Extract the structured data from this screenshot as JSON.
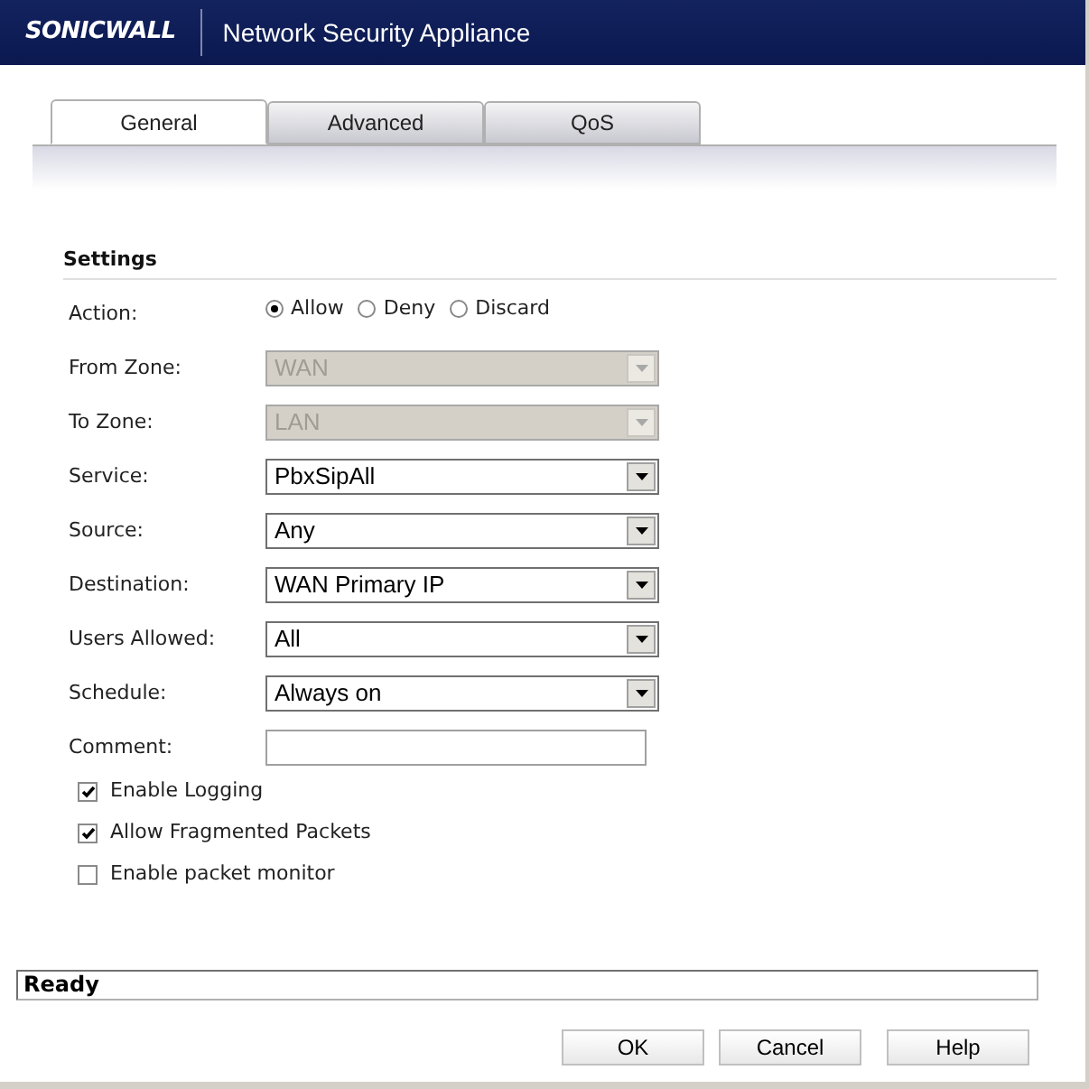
{
  "header": {
    "logo": "SONICWALL",
    "title": "Network Security Appliance"
  },
  "tabs": [
    {
      "label": "General",
      "selected": true
    },
    {
      "label": "Advanced",
      "selected": false
    },
    {
      "label": "QoS",
      "selected": false
    }
  ],
  "section": "Settings",
  "fields": [
    {
      "kind": "radio",
      "label": "Action:",
      "options": [
        {
          "label": "Allow",
          "selected": true
        },
        {
          "label": "Deny",
          "selected": false
        },
        {
          "label": "Discard",
          "selected": false
        }
      ]
    },
    {
      "kind": "select",
      "label": "From Zone:",
      "value": "WAN",
      "disabled": true
    },
    {
      "kind": "select",
      "label": "To Zone:",
      "value": "LAN",
      "disabled": true
    },
    {
      "kind": "select",
      "label": "Service:",
      "value": "PbxSipAll",
      "disabled": false
    },
    {
      "kind": "select",
      "label": "Source:",
      "value": "Any",
      "disabled": false
    },
    {
      "kind": "select",
      "label": "Destination:",
      "value": "WAN Primary IP",
      "disabled": false
    },
    {
      "kind": "select",
      "label": "Users Allowed:",
      "value": "All",
      "disabled": false
    },
    {
      "kind": "select",
      "label": "Schedule:",
      "value": "Always on",
      "disabled": false
    },
    {
      "kind": "input",
      "label": "Comment:"
    }
  ],
  "checkboxes": [
    {
      "label": "Enable Logging",
      "checked": true
    },
    {
      "label": "Allow Fragmented Packets",
      "checked": true
    },
    {
      "label": "Enable packet monitor",
      "checked": false
    }
  ],
  "status_bar": "Ready",
  "buttons": [
    "OK",
    "Cancel",
    "Help"
  ]
}
